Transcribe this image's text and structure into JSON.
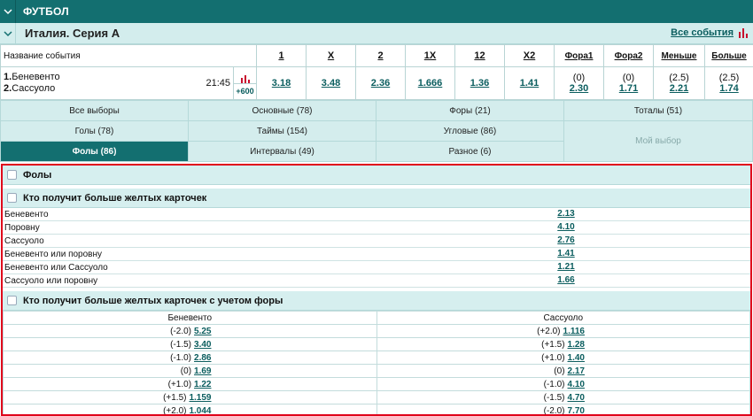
{
  "sport": {
    "title": "ФУТБОЛ",
    "toggle_icon": "chevron-down-icon"
  },
  "league": {
    "title": "Италия. Серия А",
    "all_events_label": "Все события",
    "stats_icon": "bar-chart-icon",
    "accent": "#c8102e"
  },
  "odds_table": {
    "headers": [
      "Название события",
      "1",
      "X",
      "2",
      "1X",
      "12",
      "X2",
      "Фора1",
      "Фора2",
      "Меньше",
      "Больше"
    ],
    "match": {
      "team1_num": "1.",
      "team1": "Беневенто",
      "team2_num": "2.",
      "team2": "Сассуоло",
      "time": "21:45",
      "more_markets": "+600",
      "odds": [
        "3.18",
        "3.48",
        "2.36",
        "1.666",
        "1.36",
        "1.41"
      ],
      "handicaps": [
        {
          "line": "(0)",
          "odd": "2.30"
        },
        {
          "line": "(0)",
          "odd": "1.71"
        },
        {
          "line": "(2.5)",
          "odd": "2.21"
        },
        {
          "line": "(2.5)",
          "odd": "1.74"
        }
      ]
    }
  },
  "tabs": {
    "row1": [
      "Все выборы",
      "Основные (78)",
      "Форы (21)",
      "Тоталы (51)"
    ],
    "row2": [
      "Голы (78)",
      "Таймы (154)",
      "Угловые (86)"
    ],
    "row3": [
      "Фолы (86)",
      "Интервалы (49)",
      "Разное (6)"
    ],
    "my_choice": "Мой выбор",
    "active": "Фолы (86)"
  },
  "markets": {
    "section_title": "Фолы",
    "more_yellow": {
      "title": "Кто получит больше желтых карточек",
      "rows": [
        {
          "label": "Беневенто",
          "odd": "2.13"
        },
        {
          "label": "Поровну",
          "odd": "4.10"
        },
        {
          "label": "Сассуоло",
          "odd": "2.76"
        },
        {
          "label": "Беневенто или поровну",
          "odd": "1.41"
        },
        {
          "label": "Беневенто или Сассуоло",
          "odd": "1.21"
        },
        {
          "label": "Сассуоло или поровну",
          "odd": "1.66"
        }
      ]
    },
    "more_yellow_handicap": {
      "title": "Кто получит больше желтых карточек с учетом форы",
      "col1": "Беневенто",
      "col2": "Сассуоло",
      "rows": [
        {
          "h1": "(-2.0)",
          "o1": "5.25",
          "h2": "(+2.0)",
          "o2": "1.116"
        },
        {
          "h1": "(-1.5)",
          "o1": "3.40",
          "h2": "(+1.5)",
          "o2": "1.28"
        },
        {
          "h1": "(-1.0)",
          "o1": "2.86",
          "h2": "(+1.0)",
          "o2": "1.40"
        },
        {
          "h1": "(0)",
          "o1": "1.69",
          "h2": "(0)",
          "o2": "2.17"
        },
        {
          "h1": "(+1.0)",
          "o1": "1.22",
          "h2": "(-1.0)",
          "o2": "4.10"
        },
        {
          "h1": "(+1.5)",
          "o1": "1.159",
          "h2": "(-1.5)",
          "o2": "4.70"
        },
        {
          "h1": "(+2.0)",
          "o1": "1.044",
          "h2": "(-2.0)",
          "o2": "7.70"
        }
      ]
    }
  }
}
